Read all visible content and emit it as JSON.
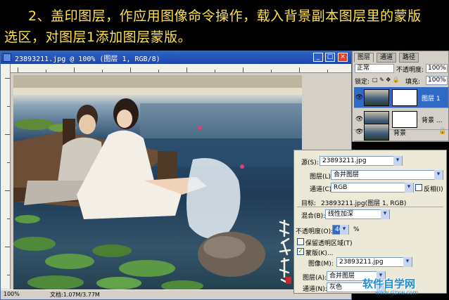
{
  "tutorial_text": {
    "line1": "2、盖印图层，作应用图像命令操作，载入背景副本图层里的蒙版",
    "line2": "选区，对图层1添加图层蒙版。"
  },
  "document": {
    "title": "23893211.jpg @ 100% (图层 1, RGB/8)",
    "window_buttons": [
      "_",
      "□",
      "×"
    ],
    "status_zoom": "100%",
    "status_doc": "文档:1.07M/3.77M"
  },
  "layers_panel": {
    "tabs": [
      "图层",
      "通道",
      "路径"
    ],
    "blend_mode": "正常",
    "opacity_label": "不透明度:",
    "opacity_value": "100%",
    "lock_label": "锁定:",
    "fill_label": "填充:",
    "fill_value": "100%",
    "layers": [
      {
        "name": "图层 1",
        "active": true,
        "has_mask": true
      },
      {
        "name": "背景 ...",
        "active": false,
        "has_mask": true
      },
      {
        "name": "背景",
        "active": false,
        "has_mask": false
      }
    ]
  },
  "apply_image_dialog": {
    "source_label": "源(S):",
    "source_value": "23893211.jpg",
    "layer_label": "图层(L):",
    "layer_value": "合并图层",
    "channel_label": "通道(C):",
    "channel_value": "RGB",
    "invert_label": "反相(I)",
    "target_label": "目标:",
    "target_value": "23893211.jpg(图层 1, RGB)",
    "blending_label": "混合(B):",
    "blending_value": "线性加深",
    "opacity_label": "不透明度(O):",
    "opacity_value": "40",
    "opacity_unit": "%",
    "preserve_label": "保留透明区域(T)",
    "mask_label": "蒙版(K)...",
    "mask_image_label": "图像(M):",
    "mask_image_value": "23893211.jpg",
    "mask_layer_label": "图层(A):",
    "mask_layer_value": "合并图层",
    "mask_channel_label": "通道(N):",
    "mask_channel_value": "灰色"
  },
  "watermark_logo": {
    "main": "软件自学网",
    "sub": "www.rjzxw.com"
  },
  "colors": {
    "banner_text": "#ffe24a",
    "titlebar": "#2f62c9",
    "active_layer": "#316ac5"
  }
}
